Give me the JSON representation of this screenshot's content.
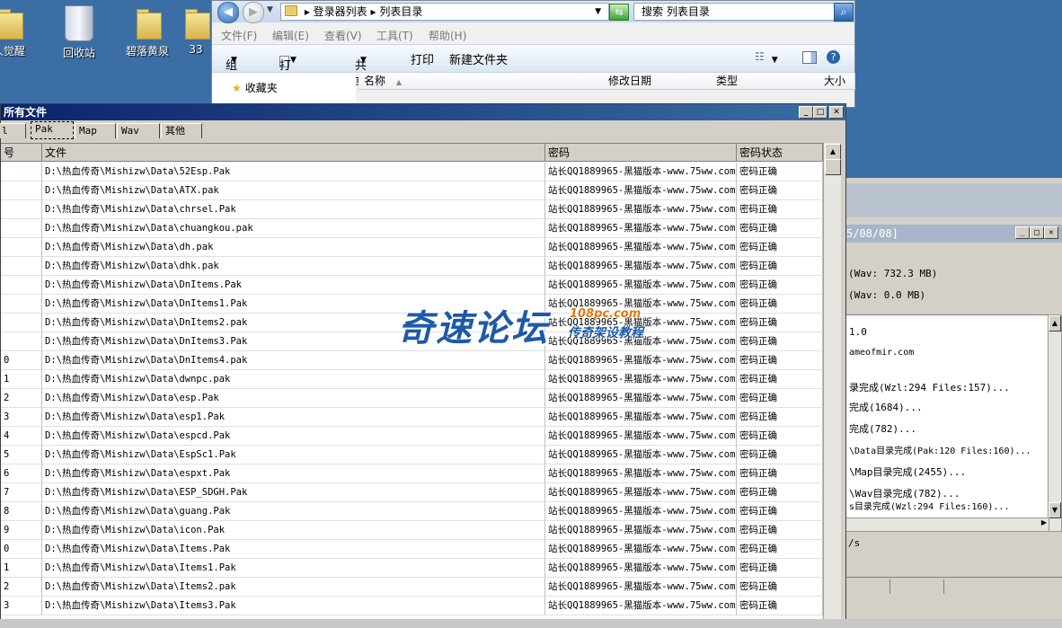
{
  "desktop": {
    "icons": [
      {
        "label": "人觉醒"
      },
      {
        "label": "回收站"
      },
      {
        "label": "碧落黄泉"
      },
      {
        "label": "33"
      }
    ]
  },
  "explorer": {
    "breadcrumb": "▸ 登录器列表 ▸ 列表目录",
    "search_placeholder": "搜索 列表目录",
    "menu": [
      "文件(F)",
      "编辑(E)",
      "查看(V)",
      "工具(T)",
      "帮助(H)"
    ],
    "toolbar": {
      "organize": "组织",
      "open": "打开",
      "share": "共享",
      "print": "打印",
      "new_folder": "新建文件夹"
    },
    "nav_favorites": "收藏夹",
    "columns": [
      "名称",
      "修改日期",
      "类型",
      "大小"
    ]
  },
  "dialog": {
    "title": "所有文件",
    "tabs": [
      "l",
      "Pak",
      "Map",
      "Wav",
      "其他"
    ],
    "selected_tab": "Pak",
    "columns": [
      "号",
      "文件",
      "密码",
      "密码状态"
    ],
    "row_numbers": [
      "",
      "",
      "",
      "",
      "",
      "",
      "",
      "",
      "",
      "",
      "0",
      "1",
      "2",
      "3",
      "4",
      "5",
      "6",
      "7",
      "8",
      "9",
      "0",
      "1",
      "2",
      "3"
    ],
    "rows": [
      {
        "file": "D:\\热血传奇\\Mishizw\\Data\\52Esp.Pak",
        "password": "站长QQ1889965-黑猫版本-www.75ww.com",
        "status": "密码正确"
      },
      {
        "file": "D:\\热血传奇\\Mishizw\\Data\\ATX.pak",
        "password": "站长QQ1889965-黑猫版本-www.75ww.com",
        "status": "密码正确"
      },
      {
        "file": "D:\\热血传奇\\Mishizw\\Data\\chrsel.Pak",
        "password": "站长QQ1889965-黑猫版本-www.75ww.com",
        "status": "密码正确"
      },
      {
        "file": "D:\\热血传奇\\Mishizw\\Data\\chuangkou.pak",
        "password": "站长QQ1889965-黑猫版本-www.75ww.com",
        "status": "密码正确"
      },
      {
        "file": "D:\\热血传奇\\Mishizw\\Data\\dh.pak",
        "password": "站长QQ1889965-黑猫版本-www.75ww.com",
        "status": "密码正确"
      },
      {
        "file": "D:\\热血传奇\\Mishizw\\Data\\dhk.pak",
        "password": "站长QQ1889965-黑猫版本-www.75ww.com",
        "status": "密码正确"
      },
      {
        "file": "D:\\热血传奇\\Mishizw\\Data\\DnItems.Pak",
        "password": "站长QQ1889965-黑猫版本-www.75ww.com",
        "status": "密码正确"
      },
      {
        "file": "D:\\热血传奇\\Mishizw\\Data\\DnItems1.Pak",
        "password": "站长QQ1889965-黑猫版本-www.75ww.com",
        "status": "密码正确"
      },
      {
        "file": "D:\\热血传奇\\Mishizw\\Data\\DnItems2.pak",
        "password": "站长QQ1889965-黑猫版本-www.75ww.com",
        "status": "密码正确"
      },
      {
        "file": "D:\\热血传奇\\Mishizw\\Data\\DnItems3.Pak",
        "password": "站长QQ1889965-黑猫版本-www.75ww.com",
        "status": "密码正确"
      },
      {
        "file": "D:\\热血传奇\\Mishizw\\Data\\DnItems4.pak",
        "password": "站长QQ1889965-黑猫版本-www.75ww.com",
        "status": "密码正确"
      },
      {
        "file": "D:\\热血传奇\\Mishizw\\Data\\dwnpc.pak",
        "password": "站长QQ1889965-黑猫版本-www.75ww.com",
        "status": "密码正确"
      },
      {
        "file": "D:\\热血传奇\\Mishizw\\Data\\esp.Pak",
        "password": "站长QQ1889965-黑猫版本-www.75ww.com",
        "status": "密码正确"
      },
      {
        "file": "D:\\热血传奇\\Mishizw\\Data\\esp1.Pak",
        "password": "站长QQ1889965-黑猫版本-www.75ww.com",
        "status": "密码正确"
      },
      {
        "file": "D:\\热血传奇\\Mishizw\\Data\\espcd.Pak",
        "password": "站长QQ1889965-黑猫版本-www.75ww.com",
        "status": "密码正确"
      },
      {
        "file": "D:\\热血传奇\\Mishizw\\Data\\EspSc1.Pak",
        "password": "站长QQ1889965-黑猫版本-www.75ww.com",
        "status": "密码正确"
      },
      {
        "file": "D:\\热血传奇\\Mishizw\\Data\\espxt.Pak",
        "password": "站长QQ1889965-黑猫版本-www.75ww.com",
        "status": "密码正确"
      },
      {
        "file": "D:\\热血传奇\\Mishizw\\Data\\ESP_SDGH.Pak",
        "password": "站长QQ1889965-黑猫版本-www.75ww.com",
        "status": "密码正确"
      },
      {
        "file": "D:\\热血传奇\\Mishizw\\Data\\guang.Pak",
        "password": "站长QQ1889965-黑猫版本-www.75ww.com",
        "status": "密码正确"
      },
      {
        "file": "D:\\热血传奇\\Mishizw\\Data\\icon.Pak",
        "password": "站长QQ1889965-黑猫版本-www.75ww.com",
        "status": "密码正确"
      },
      {
        "file": "D:\\热血传奇\\Mishizw\\Data\\Items.Pak",
        "password": "站长QQ1889965-黑猫版本-www.75ww.com",
        "status": "密码正确"
      },
      {
        "file": "D:\\热血传奇\\Mishizw\\Data\\Items1.Pak",
        "password": "站长QQ1889965-黑猫版本-www.75ww.com",
        "status": "密码正确"
      },
      {
        "file": "D:\\热血传奇\\Mishizw\\Data\\Items2.pak",
        "password": "站长QQ1889965-黑猫版本-www.75ww.com",
        "status": "密码正确"
      },
      {
        "file": "D:\\热血传奇\\Mishizw\\Data\\Items3.Pak",
        "password": "站长QQ1889965-黑猫版本-www.75ww.com",
        "status": "密码正确"
      }
    ]
  },
  "tool_window": {
    "title": "5/08/08]",
    "info_lines": [
      "(Wav: 732.3 MB)",
      "(Wav: 0.0 MB)"
    ],
    "log_lines": [
      "1.0",
      "ameofmir.com",
      "录完成(Wzl:294 Files:157)...",
      "完成(1684)...",
      "完成(782)...",
      "\\Data目录完成(Pak:120 Files:160)...",
      "\\Map目录完成(2455)...",
      "\\Wav目录完成(782)...",
      "s目录完成(Wzl:294 Files:160)..."
    ],
    "status_text": "/s"
  },
  "watermark": {
    "main": "奇速论坛",
    "site": "108pc.com",
    "sub": "传奇架设教程"
  }
}
